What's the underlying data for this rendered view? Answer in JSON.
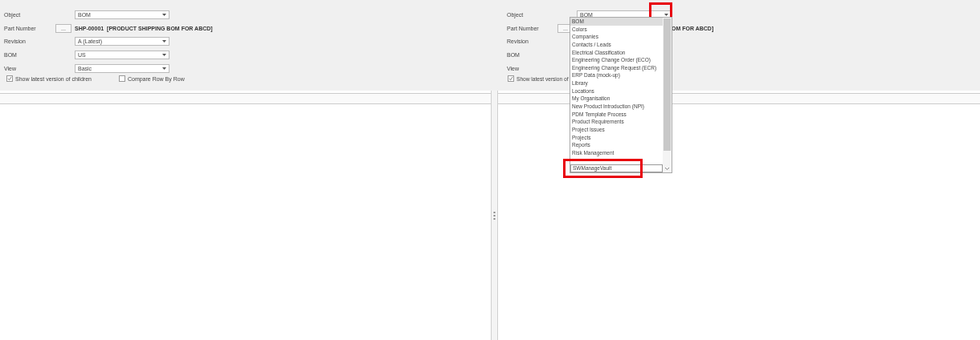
{
  "left": {
    "fields": [
      {
        "label": "Object",
        "kind": "select",
        "value": "BOM"
      },
      {
        "label": "Part Number",
        "kind": "lookup",
        "button": "...",
        "value": "SHP-00001  [PRODUCT SHIPPING BOM FOR ABCD]"
      },
      {
        "label": "Revision",
        "kind": "select",
        "value": "A  (Latest)"
      },
      {
        "label": "BOM",
        "kind": "select",
        "value": "US"
      },
      {
        "label": "View",
        "kind": "select",
        "value": "Basic"
      }
    ],
    "checkboxes": [
      {
        "label": "Show latest version of children",
        "checked": true
      },
      {
        "label": "Compare Row By Row",
        "checked": false
      }
    ]
  },
  "right": {
    "fields": [
      {
        "label": "Object",
        "kind": "select",
        "value": "BOM"
      },
      {
        "label": "Part Number",
        "kind": "lookup",
        "button": "...",
        "value": "OM FOR ABCD]"
      },
      {
        "label": "Revision",
        "kind": "covered"
      },
      {
        "label": "BOM",
        "kind": "covered"
      },
      {
        "label": "View",
        "kind": "covered"
      }
    ],
    "checkboxes": [
      {
        "label": "Show latest version of",
        "checked": true
      }
    ]
  },
  "dropdown": {
    "items": [
      {
        "label": "BOM",
        "selected": true,
        "hovered": false
      },
      {
        "label": "Colors",
        "selected": false,
        "hovered": false
      },
      {
        "label": "Companies",
        "selected": false,
        "hovered": false
      },
      {
        "label": "Contacts / Leads",
        "selected": false,
        "hovered": false
      },
      {
        "label": "Electrical Classification",
        "selected": false,
        "hovered": false
      },
      {
        "label": "Engineering Change Order (ECO)",
        "selected": false,
        "hovered": false
      },
      {
        "label": "Engineering Change Request (ECR)",
        "selected": false,
        "hovered": false
      },
      {
        "label": "ERP Data (mock-up)",
        "selected": false,
        "hovered": false
      },
      {
        "label": "Library",
        "selected": false,
        "hovered": false
      },
      {
        "label": "Locations",
        "selected": false,
        "hovered": false
      },
      {
        "label": "My Organisation",
        "selected": false,
        "hovered": false
      },
      {
        "label": "New Product Introduction (NPI)",
        "selected": false,
        "hovered": false
      },
      {
        "label": "PDM Template Process",
        "selected": false,
        "hovered": false
      },
      {
        "label": "Product Requirements",
        "selected": false,
        "hovered": false
      },
      {
        "label": "Project Issues",
        "selected": false,
        "hovered": false
      },
      {
        "label": "Projects",
        "selected": false,
        "hovered": false
      },
      {
        "label": "Reports",
        "selected": false,
        "hovered": false
      },
      {
        "label": "Risk Management",
        "selected": false,
        "hovered": false
      },
      {
        "label": "SWManageVault",
        "selected": false,
        "hovered": true
      }
    ]
  }
}
